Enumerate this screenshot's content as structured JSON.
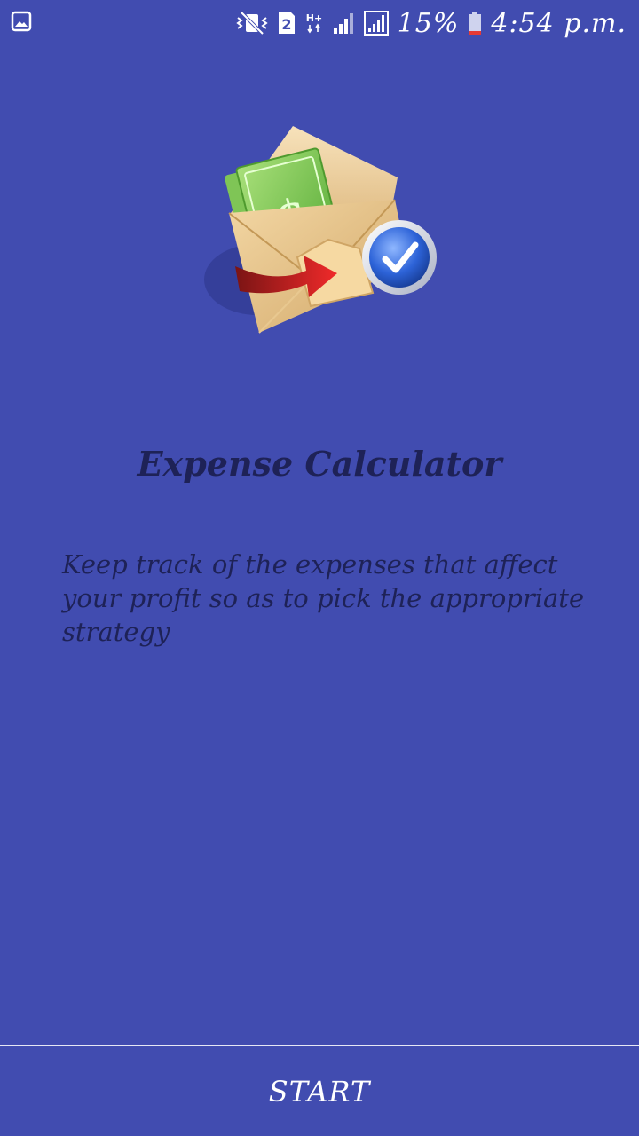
{
  "status_bar": {
    "sim_slot": "2",
    "network_type": "H+",
    "battery_percent": "15%",
    "time": "4:54 p.m.",
    "icons": [
      "image-notification-icon",
      "vibrate-icon",
      "sim-2-icon",
      "hplus-data-icon",
      "signal-icon",
      "signal-icon-2",
      "battery-icon"
    ]
  },
  "main": {
    "logo_icon": "envelope-money-checkmark-logo",
    "title": "Expense Calculator",
    "description": "Keep track of the expenses that affect your profit so as to pick the appropriate strategy"
  },
  "footer": {
    "start_label": "START"
  },
  "colors": {
    "background": "#414cb0",
    "title_text": "#1e2257",
    "button_text": "#ffffff"
  }
}
